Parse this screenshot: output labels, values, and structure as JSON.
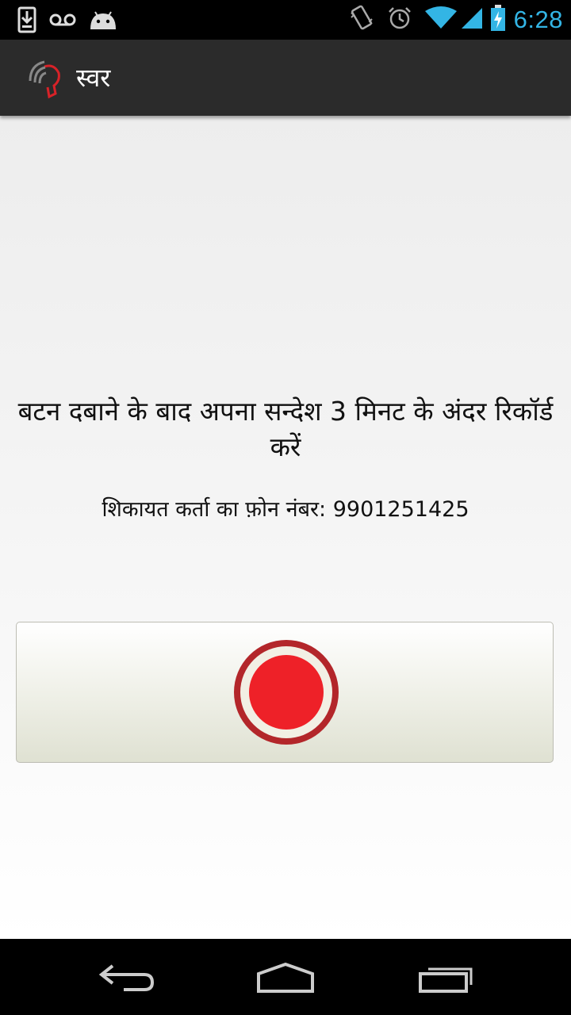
{
  "status_bar": {
    "time": "6:28",
    "left_icons": [
      "download-icon",
      "voicemail-icon",
      "android-debug-icon"
    ],
    "right_icons": [
      "vibrate-icon",
      "alarm-icon",
      "wifi-icon",
      "signal-icon",
      "battery-charging-icon"
    ]
  },
  "action_bar": {
    "title": "स्वर",
    "logo_icon": "swara-logo-icon"
  },
  "main": {
    "instruction": "बटन दबाने के बाद अपना सन्देश 3 मिनट के अंदर रिकॉर्ड करें",
    "phone_line": "शिकायत कर्ता का फ़ोन नंबर: 9901251425",
    "record_button_icon": "record-icon"
  },
  "nav_bar": {
    "buttons": [
      "back-icon",
      "home-icon",
      "recent-apps-icon"
    ]
  },
  "colors": {
    "status_time": "#33b5e5",
    "action_bar_bg": "#2b2b2b",
    "record_outer": "#b3262a",
    "record_inner": "#ee2128"
  }
}
